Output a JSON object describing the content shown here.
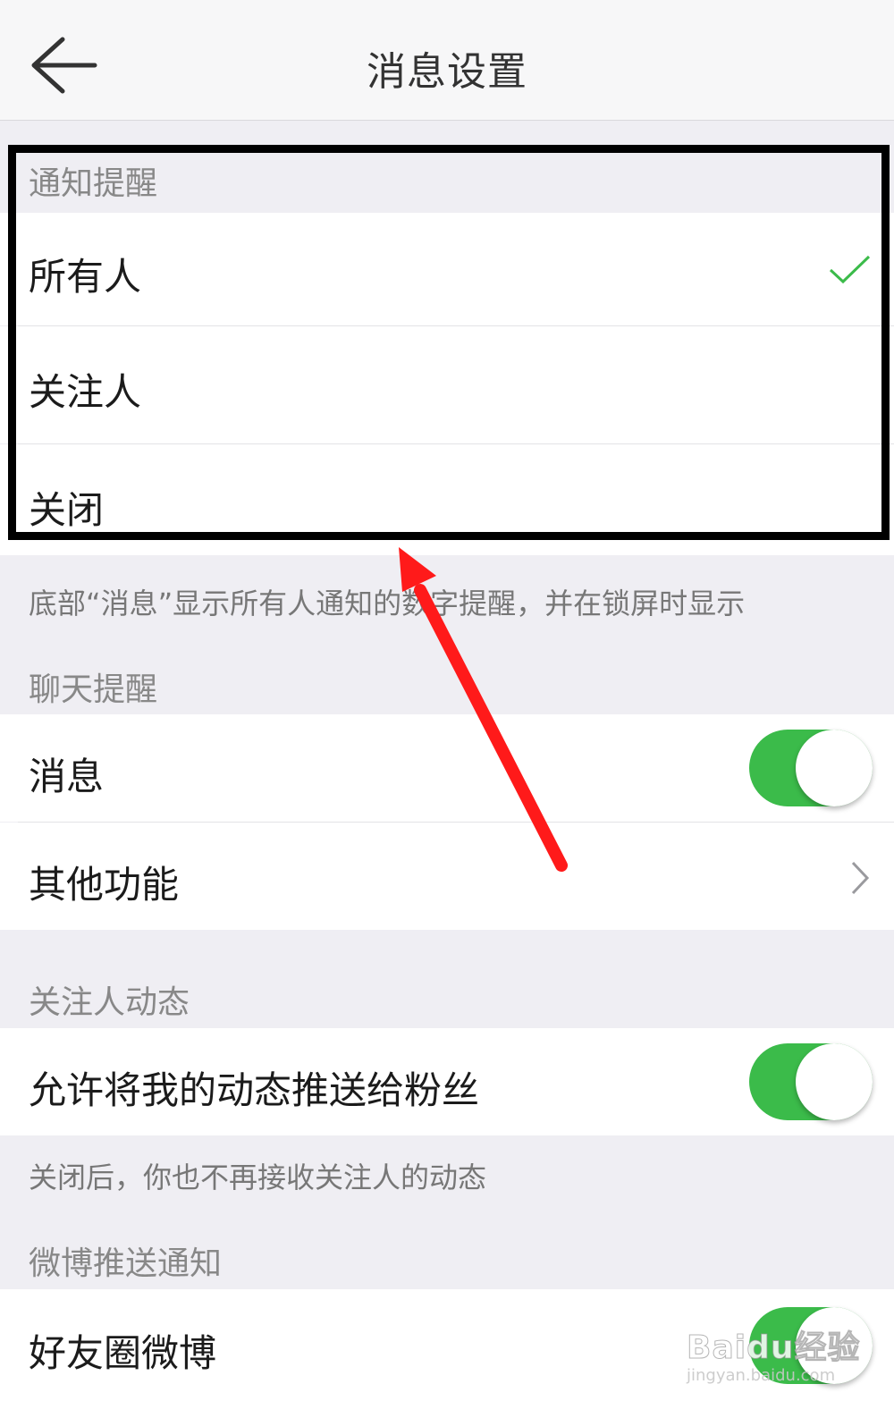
{
  "header": {
    "title": "消息设置",
    "back_icon": "back-arrow-icon"
  },
  "notify": {
    "heading": "通知提醒",
    "options": [
      {
        "label": "所有人",
        "selected": true
      },
      {
        "label": "关注人",
        "selected": false
      },
      {
        "label": "关闭",
        "selected": false
      }
    ],
    "note": "底部“消息”显示所有人通知的数字提醒，并在锁屏时显示"
  },
  "chat": {
    "heading": "聊天提醒",
    "message_label": "消息",
    "message_on": true,
    "other_label": "其他功能"
  },
  "follow": {
    "heading": "关注人动态",
    "push_label": "允许将我的动态推送给粉丝",
    "push_on": true,
    "note": "关闭后，你也不再接收关注人的动态"
  },
  "weibo": {
    "heading": "微博推送通知",
    "friends_label": "好友圈微博",
    "friends_on": true
  },
  "watermark": {
    "main": "Baidu经验",
    "sub": "jingyan.baidu.com"
  },
  "colors": {
    "toggle_on": "#3bbb4a",
    "check": "#3bbb4a",
    "annotation_arrow": "#ff1a1a",
    "annotation_box": "#000000"
  }
}
